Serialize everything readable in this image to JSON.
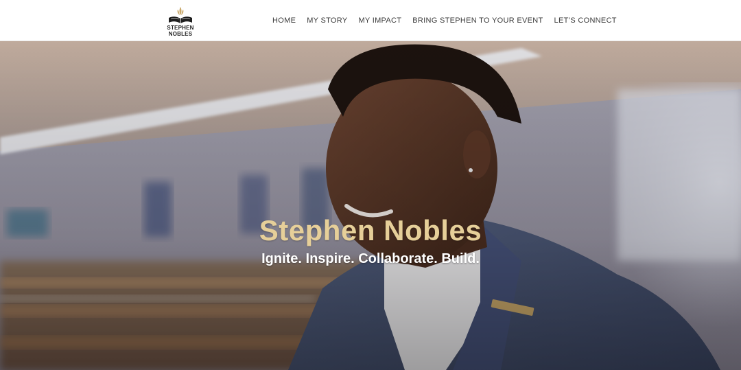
{
  "brand": {
    "logo_line1": "STEPHEN",
    "logo_line2": "NOBLES",
    "logo_color": "#1f1f1f",
    "logo_accent": "#c9a86a"
  },
  "nav": {
    "items": [
      {
        "label": "HOME"
      },
      {
        "label": "MY STORY"
      },
      {
        "label": "MY IMPACT"
      },
      {
        "label": "BRING STEPHEN TO YOUR EVENT"
      },
      {
        "label": "LET’S CONNECT"
      }
    ]
  },
  "hero": {
    "title": "Stephen Nobles",
    "subtitle": "Ignite. Inspire. Collaborate. Build.",
    "title_color": "#e6cf99",
    "subtitle_color": "#ffffff"
  }
}
